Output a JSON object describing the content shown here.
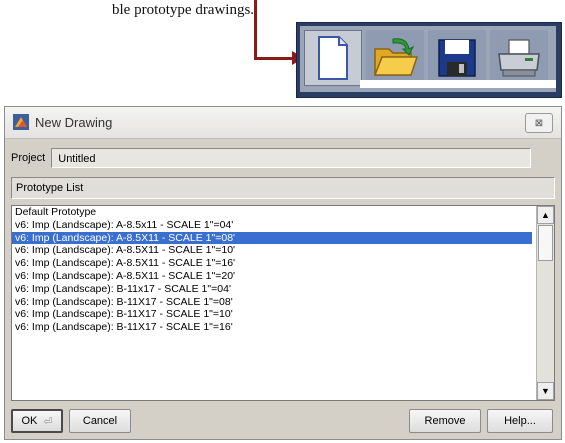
{
  "doc_text": "ble prototype drawings.",
  "toolbar": {
    "buttons": [
      {
        "icon": "new-document-icon",
        "active": true
      },
      {
        "icon": "open-folder-icon",
        "active": false
      },
      {
        "icon": "save-disk-icon",
        "active": false
      },
      {
        "icon": "printer-icon",
        "active": false
      }
    ]
  },
  "colors": {
    "arrow": "#8b1a1a",
    "selection": "#3a6fd0",
    "toolbar_frame": "#2b3d63"
  },
  "dialog": {
    "title": "New Drawing",
    "close_symbol": "⊠",
    "project_label": "Project",
    "project_value": "Untitled",
    "prototype_list_header": "Prototype List",
    "items": [
      "Default Prototype",
      "v6: Imp (Landscape): A-8.5x11 - SCALE 1\"=04'",
      "v6: Imp (Landscape): A-8.5X11 - SCALE 1\"=08'",
      "v6: Imp (Landscape): A-8.5X11 - SCALE 1\"=10'",
      "v6: Imp (Landscape): A-8.5X11 - SCALE 1\"=16'",
      "v6: Imp (Landscape): A-8.5X11 - SCALE 1\"=20'",
      "v6: Imp (Landscape): B-11x17 - SCALE 1\"=04'",
      "v6: Imp (Landscape): B-11X17 - SCALE 1\"=08'",
      "v6: Imp (Landscape): B-11X17 - SCALE 1\"=10'",
      "v6: Imp (Landscape): B-11X17 - SCALE 1\"=16'"
    ],
    "selected_index": 2,
    "buttons": {
      "ok": "OK",
      "cancel": "Cancel",
      "remove": "Remove",
      "help": "Help..."
    },
    "scroll_up": "▲",
    "scroll_down": "▼"
  }
}
